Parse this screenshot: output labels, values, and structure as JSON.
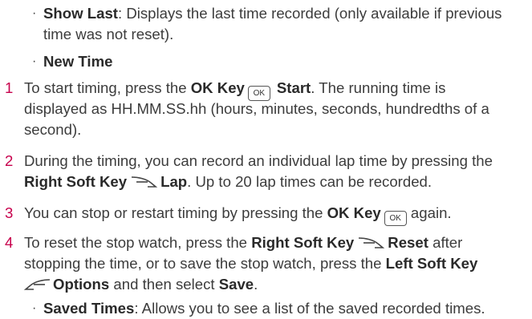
{
  "sub_items_top": [
    {
      "label": "Show Last",
      "text": ": Displays the last time recorded (only available if previous",
      "cont": "time was not reset)."
    },
    {
      "label": "New Time"
    }
  ],
  "ok_key_icon": "OK",
  "steps": [
    {
      "num": "1",
      "a": "To start timing, press the ",
      "k1": "OK Key",
      "k1b": "Start",
      "b": ". The running time is",
      "c": "displayed as HH.MM.SS.hh (hours, minutes, seconds, hundredths of a",
      "d": "second)."
    },
    {
      "num": "2",
      "a": "During the timing, you can record an individual lap time by pressing the",
      "k1": "Right Soft Key",
      "k1b": "Lap",
      "b": ". Up to 20 lap times can be recorded."
    },
    {
      "num": "3",
      "a": "You can stop or restart timing by pressing the ",
      "k1": "OK Key",
      "b": " again."
    },
    {
      "num": "4",
      "a": "To reset the stop watch, press the ",
      "k1": "Right Soft Key",
      "k1b": "Reset",
      "b": " after",
      "c": "stopping the time, or to save the stop watch, press the ",
      "k2": "Left Soft Key",
      "k2b": "Options",
      "d": " and then select ",
      "k3": "Save",
      "e": "."
    }
  ],
  "sub_items_bottom": [
    {
      "label": "Saved Times",
      "text": ": Allows you to see a list of the saved recorded times."
    }
  ]
}
